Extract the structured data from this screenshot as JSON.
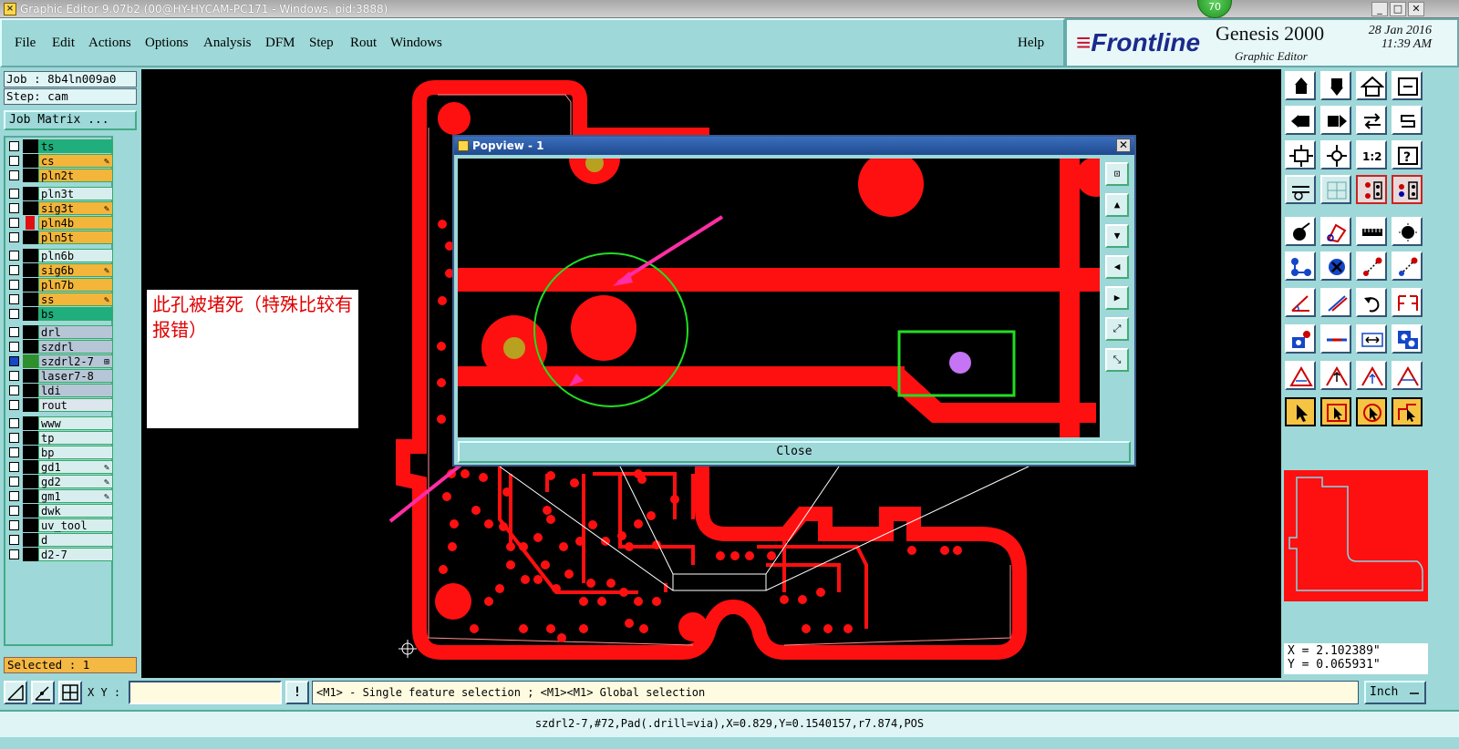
{
  "window": {
    "title": "Graphic Editor 9.07b2 (00@HY-HYCAM-PC171 - Windows, pid:3888)",
    "badge": "70",
    "min_label": "_",
    "max_label": "□",
    "close_label": "✕"
  },
  "menu": {
    "file": "File",
    "edit": "Edit",
    "actions": "Actions",
    "options": "Options",
    "analysis": "Analysis",
    "dfm": "DFM",
    "step": "Step",
    "rout": "Rout",
    "windows": "Windows",
    "help": "Help"
  },
  "brand": {
    "logo": "Frontline",
    "product": "Genesis 2000",
    "subtitle": "Graphic Editor",
    "date": "28 Jan 2016",
    "time": "11:39 AM"
  },
  "left": {
    "job": "Job : 8b4ln009a0",
    "step": "Step: cam",
    "job_matrix": "Job Matrix ...",
    "selected": "Selected : 1"
  },
  "layers": [
    {
      "name": "ts",
      "color": "#1fae7c",
      "mark": ""
    },
    {
      "name": "cs",
      "color": "#f3b53a",
      "mark": "✎"
    },
    {
      "name": "pln2t",
      "color": "#f3b53a",
      "mark": ""
    },
    {
      "name": "pln3t",
      "color": "#d8eeee",
      "mark": ""
    },
    {
      "name": "sig3t",
      "color": "#f3b53a",
      "mark": "✎"
    },
    {
      "name": "pln4b",
      "color": "#f3b53a",
      "mark": ""
    },
    {
      "name": "pln5t",
      "color": "#f3b53a",
      "mark": ""
    },
    {
      "name": "pln6b",
      "color": "#d8eeee",
      "mark": ""
    },
    {
      "name": "sig6b",
      "color": "#f3b53a",
      "mark": "✎"
    },
    {
      "name": "pln7b",
      "color": "#f3b53a",
      "mark": ""
    },
    {
      "name": "ss",
      "color": "#f3b53a",
      "mark": "✎"
    },
    {
      "name": "bs",
      "color": "#1fae7c",
      "mark": ""
    },
    {
      "name": "drl",
      "color": "#b7c6d6",
      "mark": ""
    },
    {
      "name": "szdrl",
      "color": "#b7c6d6",
      "mark": ""
    },
    {
      "name": "szdrl2-7",
      "color": "#b7c6d6",
      "mark": "⊞"
    },
    {
      "name": "laser7-8",
      "color": "#b7c6d6",
      "mark": ""
    },
    {
      "name": "ldi",
      "color": "#b7c6d6",
      "mark": ""
    },
    {
      "name": "rout",
      "color": "#dde6ee",
      "mark": ""
    },
    {
      "name": "www",
      "color": "#d8eeee",
      "mark": ""
    },
    {
      "name": "tp",
      "color": "#d8eeee",
      "mark": ""
    },
    {
      "name": "bp",
      "color": "#d8eeee",
      "mark": ""
    },
    {
      "name": "gd1",
      "color": "#d8eeee",
      "mark": "✎"
    },
    {
      "name": "gd2",
      "color": "#d8eeee",
      "mark": "✎"
    },
    {
      "name": "gm1",
      "color": "#d8eeee",
      "mark": "✎"
    },
    {
      "name": "dwk",
      "color": "#d8eeee",
      "mark": ""
    },
    {
      "name": "uv_tool",
      "color": "#d8eeee",
      "mark": ""
    },
    {
      "name": "d",
      "color": "#d8eeee",
      "mark": ""
    },
    {
      "name": "d2-7",
      "color": "#d8eeee",
      "mark": ""
    }
  ],
  "annotation": {
    "text": "此孔被堵死（特殊比较有报错）"
  },
  "popview": {
    "title": "Popview - 1",
    "close_x": "✕",
    "close_button": "Close"
  },
  "tools": {
    "one_to_two": "1:2",
    "help": "?"
  },
  "coords": {
    "x": "X = 2.102389\"",
    "y": "Y = 0.065931\""
  },
  "command": {
    "xy_label": "X Y :",
    "xy_value": "",
    "warn": "!",
    "message": "<M1> - Single feature selection ; <M1><M1> Global selection",
    "unit": "Inch"
  },
  "status": {
    "text": "szdrl2-7,#72,Pad(.drill=via),X=0.829,Y=0.1540157,r7.874,POS"
  }
}
